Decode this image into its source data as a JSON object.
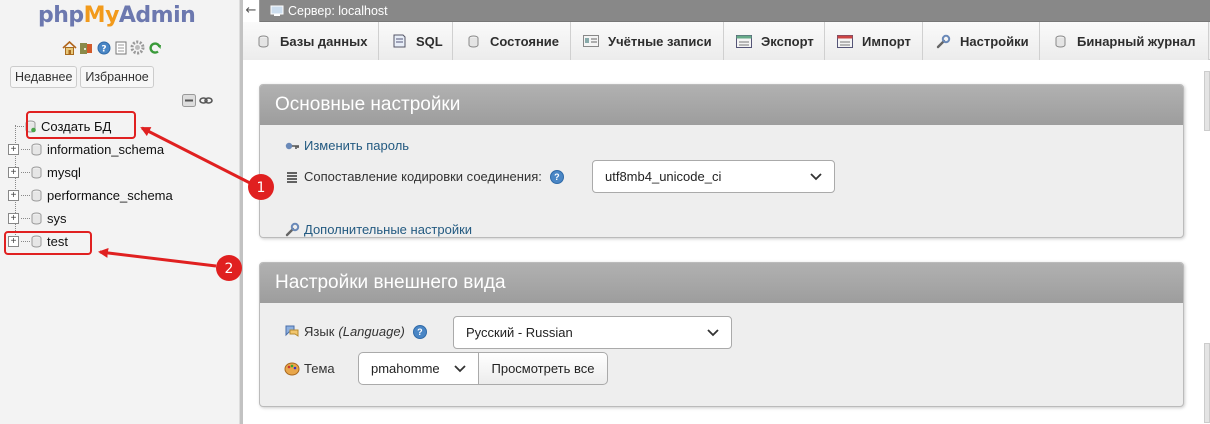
{
  "logo": {
    "part1": "php",
    "part2": "My",
    "part3": "Admin"
  },
  "nav_icons": [
    "home-icon",
    "exit-icon",
    "help-icon",
    "docs-icon",
    "settings-icon",
    "reload-icon"
  ],
  "nav_buttons": {
    "recent": "Недавнее",
    "favorites": "Избранное"
  },
  "tree": {
    "new_db": "Создать БД",
    "databases": [
      "information_schema",
      "mysql",
      "performance_schema",
      "sys",
      "test"
    ]
  },
  "annotations": {
    "marker1": "1",
    "marker2": "2",
    "color": "#e02020"
  },
  "server_bar": {
    "back": "←",
    "title": "Сервер: localhost"
  },
  "tabs": [
    "Базы данных",
    "SQL",
    "Состояние",
    "Учётные записи",
    "Экспорт",
    "Импорт",
    "Настройки",
    "Бинарный журнал"
  ],
  "general": {
    "title": "Основные настройки",
    "change_password": "Изменить пароль",
    "collation_label": "Сопоставление кодировки соединения:",
    "collation_value": "utf8mb4_unicode_ci",
    "more_settings": "Дополнительные настройки"
  },
  "appearance": {
    "title": "Настройки внешнего вида",
    "language_label": "Язык",
    "language_hint": "(Language)",
    "language_value": "Русский - Russian",
    "theme_label": "Тема",
    "theme_value": "pmahomme",
    "view_all": "Просмотреть все"
  },
  "colors": {
    "link": "#235a81",
    "panel_header": "#a4a4a4",
    "logo_blue": "#6c78af",
    "logo_orange": "#f29a1b"
  }
}
